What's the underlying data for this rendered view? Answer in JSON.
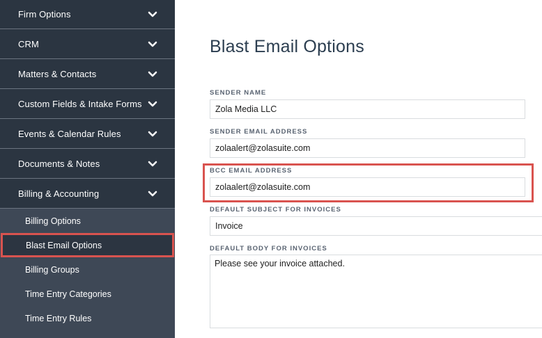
{
  "sidebar": {
    "sections": [
      {
        "label": "Firm Options"
      },
      {
        "label": "CRM"
      },
      {
        "label": "Matters & Contacts"
      },
      {
        "label": "Custom Fields & Intake Forms"
      },
      {
        "label": "Events & Calendar Rules"
      },
      {
        "label": "Documents & Notes"
      },
      {
        "label": "Billing & Accounting"
      }
    ],
    "sub_items": [
      {
        "label": "Billing Options"
      },
      {
        "label": "Blast Email Options",
        "active": true
      },
      {
        "label": "Billing Groups"
      },
      {
        "label": "Time Entry Categories"
      },
      {
        "label": "Time Entry Rules"
      }
    ]
  },
  "main": {
    "title": "Blast Email Options",
    "fields": {
      "sender_name": {
        "label": "SENDER NAME",
        "value": "Zola Media LLC"
      },
      "sender_email": {
        "label": "SENDER EMAIL ADDRESS",
        "value": "zolaalert@zolasuite.com"
      },
      "bcc_email": {
        "label": "BCC EMAIL ADDRESS",
        "value": "zolaalert@zolasuite.com"
      },
      "subject": {
        "label": "DEFAULT SUBJECT FOR INVOICES",
        "value": "Invoice"
      },
      "body": {
        "label": "DEFAULT BODY FOR INVOICES",
        "value": "Please see your invoice attached."
      }
    }
  },
  "colors": {
    "sidebar_bg": "#2b3541",
    "subpanel_bg": "#3e4856",
    "highlight": "#d9534f"
  }
}
